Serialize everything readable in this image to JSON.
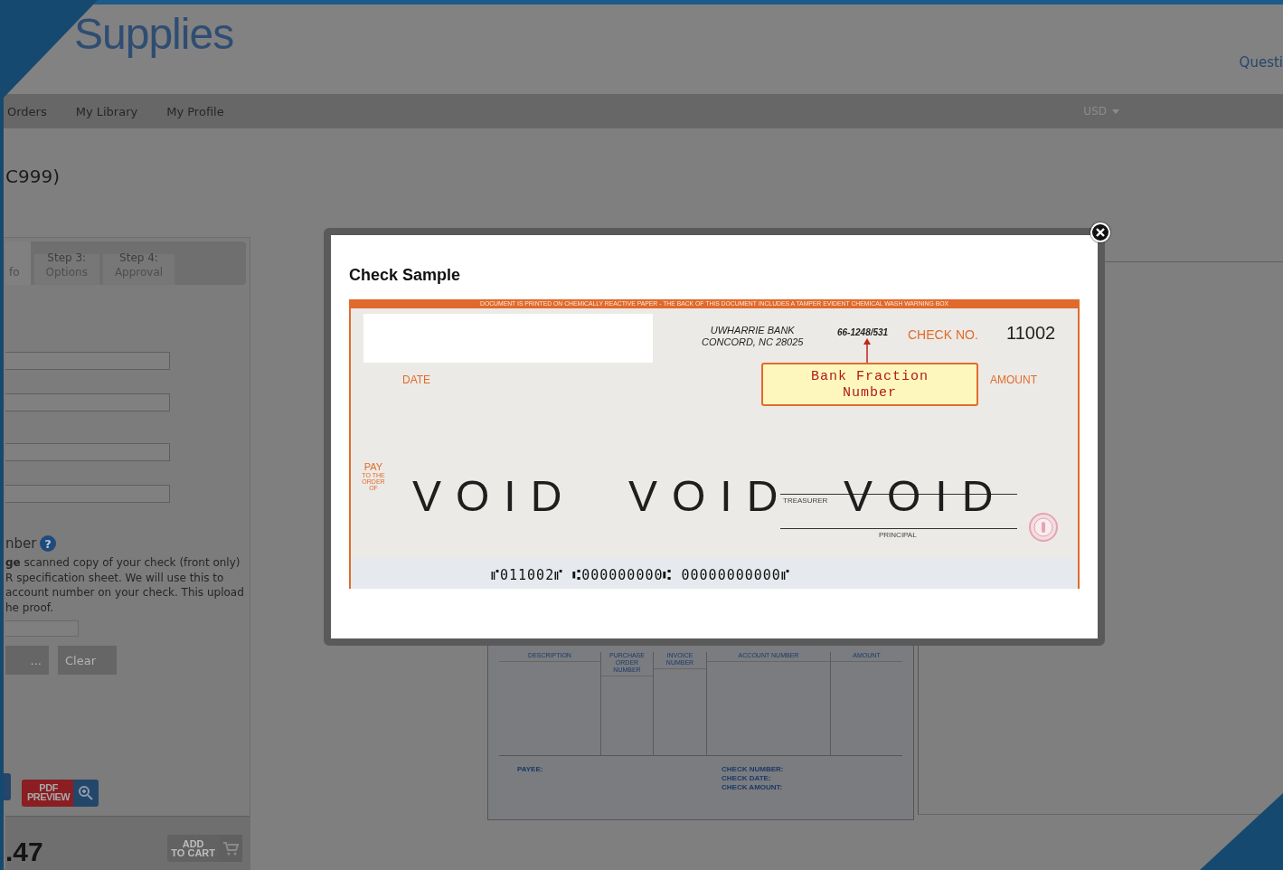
{
  "header": {
    "logo": "Supplies",
    "link": "Questi"
  },
  "nav": {
    "items": [
      {
        "label": "Orders"
      },
      {
        "label": "My Library"
      },
      {
        "label": "My Profile"
      }
    ],
    "currency": "USD"
  },
  "page_title": "C999)",
  "steps": [
    {
      "lines": [
        "fo"
      ],
      "selected": true
    },
    {
      "lines": [
        "Step 3:",
        "Options"
      ],
      "selected": false
    },
    {
      "lines": [
        "Step 4:",
        "Approval"
      ],
      "selected": false
    }
  ],
  "fields": [
    {
      "kind": "text"
    },
    {
      "kind": "text"
    },
    {
      "kind": "text"
    },
    {
      "kind": "text"
    }
  ],
  "upload": {
    "heading": "nber",
    "help_icon": "?",
    "help_lines": [
      "**ge** scanned copy of your check (front only)",
      "R specification sheet. We will use this to",
      "account number on your check. This upload",
      "he proof."
    ],
    "buttons": [
      "...",
      "Clear"
    ]
  },
  "pdf_preview": {
    "lines": [
      "PDF",
      "PREVIEW"
    ]
  },
  "price": ".47",
  "add_to_cart": {
    "lines": [
      "ADD",
      "TO CART"
    ]
  },
  "preview": {
    "columns": [
      "DESCRIPTION",
      "PURCHASE ORDER NUMBER",
      "INVOICE NUMBER",
      "ACCOUNT NUMBER",
      "AMOUNT"
    ],
    "payee": "PAYEE:",
    "check_fields": [
      "CHECK NUMBER:",
      "CHECK DATE:",
      "CHECK AMOUNT:"
    ]
  },
  "modal": {
    "title": "Check Sample",
    "check": {
      "warning": "DOCUMENT IS PRINTED ON CHEMICALLY REACTIVE PAPER - THE BACK OF THIS DOCUMENT INCLUDES A TAMPER EVIDENT CHEMICAL WASH WARNING BOX",
      "bank_lines": [
        "UWHARRIE BANK",
        "CONCORD, NC  28025"
      ],
      "fraction": "66-1248/531",
      "check_no_label": "CHECK NO.",
      "check_no": "11002",
      "callout": "Bank Fraction Number",
      "date_label": "DATE",
      "amount_label": "AMOUNT",
      "pay_lines": [
        "PAY",
        "TO THE",
        "ORDER",
        "OF"
      ],
      "voids": [
        "VOID",
        "VOID",
        "VOID"
      ],
      "treasurer": "TREASURER",
      "principal": "PRINCIPAL",
      "micr": "⑈011002⑈ ⑆000000000⑆ 00000000000⑈"
    }
  }
}
